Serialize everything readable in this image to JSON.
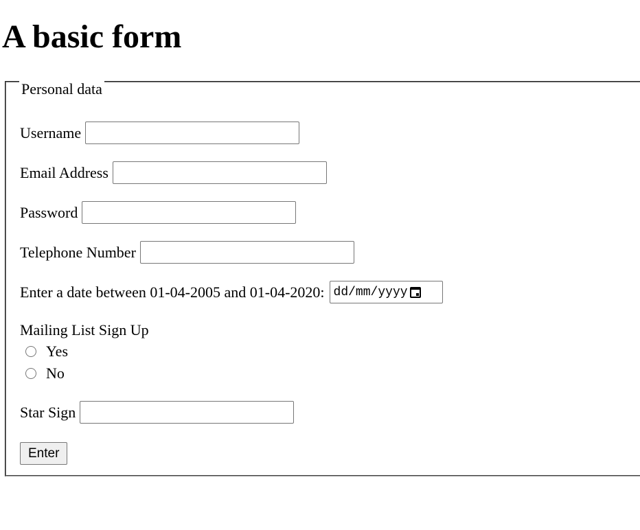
{
  "page": {
    "title": "A basic form"
  },
  "form": {
    "legend": "Personal data",
    "username_label": "Username",
    "email_label": "Email Address",
    "password_label": "Password",
    "telephone_label": "Telephone Number",
    "date_label": "Enter a date between 01-04-2005 and 01-04-2020:",
    "date_placeholder": "dd/mm/yyyy",
    "mailing_label": "Mailing List Sign Up",
    "mailing_options": [
      "Yes",
      "No"
    ],
    "starsign_label": "Star Sign",
    "submit_label": "Enter"
  }
}
